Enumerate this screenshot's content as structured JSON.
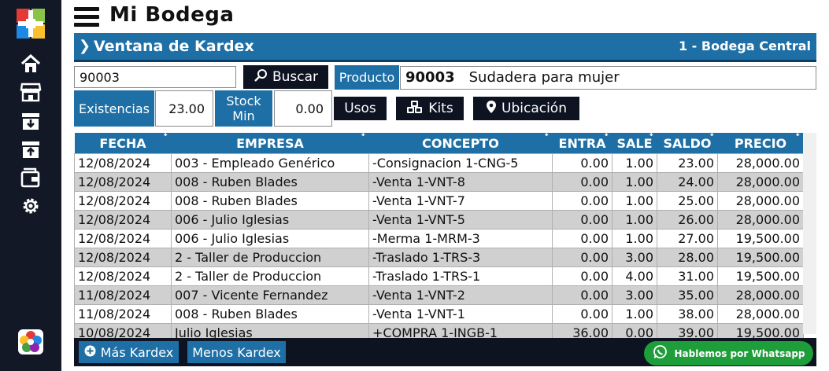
{
  "app": {
    "title": "Mi Bodega"
  },
  "window": {
    "title": "Ventana de Kardex",
    "bodega": "1 - Bodega Central"
  },
  "search": {
    "value": "90003",
    "button_label": "Buscar"
  },
  "product": {
    "label": "Producto",
    "code": "90003",
    "name": "Sudadera para mujer"
  },
  "stock": {
    "existencias_label": "Existencias",
    "existencias_value": "23.00",
    "stockmin_label_line1": "Stock",
    "stockmin_label_line2": "Min",
    "stockmin_value": "0.00"
  },
  "actions": {
    "usos": "Usos",
    "kits": "Kits",
    "ubicacion": "Ubicación"
  },
  "table": {
    "headers": [
      "FECHA",
      "EMPRESA",
      "CONCEPTO",
      "ENTRA",
      "SALE",
      "SALDO",
      "PRECIO"
    ],
    "rows": [
      [
        "12/08/2024",
        "003 - Empleado Genérico",
        "-Consignacion 1-CNG-5",
        "0.00",
        "1.00",
        "23.00",
        "28,000.00"
      ],
      [
        "12/08/2024",
        "008 - Ruben Blades",
        "-Venta 1-VNT-8",
        "0.00",
        "1.00",
        "24.00",
        "28,000.00"
      ],
      [
        "12/08/2024",
        "008 - Ruben Blades",
        "-Venta 1-VNT-7",
        "0.00",
        "1.00",
        "25.00",
        "28,000.00"
      ],
      [
        "12/08/2024",
        "006 - Julio Iglesias",
        "-Venta 1-VNT-5",
        "0.00",
        "1.00",
        "26.00",
        "28,000.00"
      ],
      [
        "12/08/2024",
        "006 - Julio Iglesias",
        "-Merma 1-MRM-3",
        "0.00",
        "1.00",
        "27.00",
        "19,500.00"
      ],
      [
        "12/08/2024",
        "2 - Taller de Produccion",
        "-Traslado 1-TRS-3",
        "0.00",
        "3.00",
        "28.00",
        "19,500.00"
      ],
      [
        "12/08/2024",
        "2 - Taller de Produccion",
        "-Traslado 1-TRS-1",
        "0.00",
        "4.00",
        "31.00",
        "19,500.00"
      ],
      [
        "11/08/2024",
        "007 - Vicente Fernandez",
        "-Venta 1-VNT-2",
        "0.00",
        "3.00",
        "35.00",
        "28,000.00"
      ],
      [
        "11/08/2024",
        "008 - Ruben Blades",
        "-Venta 1-VNT-1",
        "0.00",
        "1.00",
        "38.00",
        "28,000.00"
      ],
      [
        "10/08/2024",
        "Julio Iglesias",
        "+COMPRA 1-INGB-1",
        "36.00",
        "0.00",
        "39.00",
        "19,500.00"
      ]
    ]
  },
  "bottom": {
    "mas": "Más Kardex",
    "menos": "Menos Kardex",
    "whatsapp": "Hablemos por Whatsapp"
  },
  "sidebar": {
    "icons": [
      "home-icon",
      "store-icon",
      "inbox-download-icon",
      "inbox-upload-icon",
      "wallet-icon",
      "gear-icon"
    ]
  },
  "colors": {
    "primary": "#1e6fa6",
    "dark": "#0d1321",
    "sidebar": "#121826",
    "whatsapp": "#1e9e3a",
    "row_alt": "#d0d0d0"
  }
}
